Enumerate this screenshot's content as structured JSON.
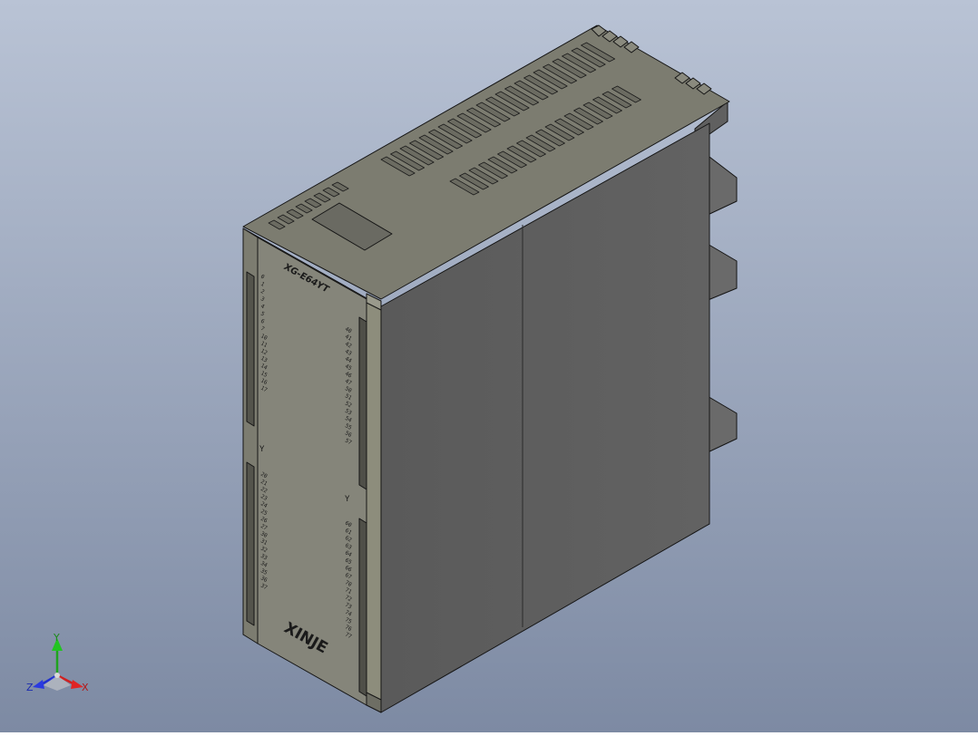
{
  "model": {
    "label": "XG-E64YT",
    "brand": "XINJE",
    "port_label": "Y",
    "left_column_numbers": [
      "0",
      "1",
      "2",
      "3",
      "4",
      "5",
      "6",
      "7",
      "10",
      "11",
      "12",
      "13",
      "14",
      "15",
      "16",
      "17"
    ],
    "left_column_lower": [
      "20",
      "21",
      "22",
      "23",
      "24",
      "25",
      "26",
      "27",
      "30",
      "31",
      "32",
      "33",
      "34",
      "35",
      "36",
      "37"
    ],
    "right_column_numbers": [
      "40",
      "41",
      "42",
      "43",
      "44",
      "45",
      "46",
      "47",
      "50",
      "51",
      "52",
      "53",
      "54",
      "55",
      "56",
      "57"
    ],
    "right_column_lower": [
      "60",
      "61",
      "62",
      "63",
      "64",
      "65",
      "66",
      "67",
      "70",
      "71",
      "72",
      "73",
      "74",
      "75",
      "76",
      "77"
    ]
  },
  "triad": {
    "x": "X",
    "y": "Y",
    "z": "Z"
  },
  "colors": {
    "background_top": "#b8c2d4",
    "background_bottom": "#7f8ca4",
    "front_face": "#8a8a78",
    "side_face": "#5e5e5e",
    "top_face": "#7e7e72",
    "edge": "#1a1a1a"
  }
}
